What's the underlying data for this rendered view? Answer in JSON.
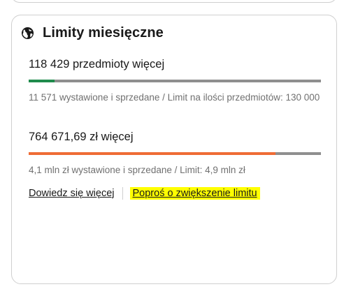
{
  "panel": {
    "title": "Limity miesięczne",
    "icon": "globe-icon"
  },
  "items_limit": {
    "remaining": "118 429 przedmioty więcej",
    "used_label": "11 571 wystawione i sprzedane /",
    "limit_label": "Limit na ilości przedmiotów: 130 000",
    "used_fraction": 0.089,
    "bar_color": "#1f8b4c"
  },
  "value_limit": {
    "remaining": "764 671,69 zł więcej",
    "used_label": "4,1 mln zł wystawione i sprzedane /",
    "limit_label": "Limit: 4,9 mln zł",
    "used_fraction": 0.844,
    "bar_color": "#ef6c35"
  },
  "links": {
    "learn_more": "Dowiedz się więcej",
    "request_increase": "Poproś o zwiększenie limitu",
    "highlight_color": "#ffff00"
  },
  "colors": {
    "track": "#8f8f8f",
    "border": "#cfcfcf"
  }
}
